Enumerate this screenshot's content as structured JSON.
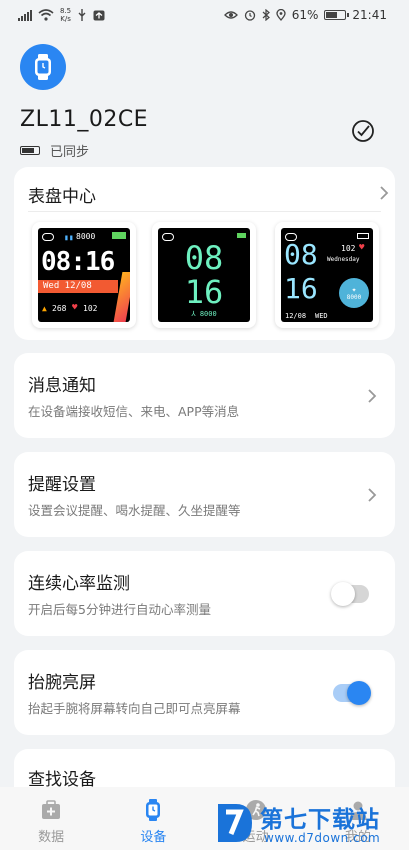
{
  "status_bar": {
    "net_speed_value": "8.5",
    "net_speed_unit": "K/s",
    "battery_percent": "61%",
    "battery_level": 0.61,
    "time": "21:41"
  },
  "device": {
    "name": "ZL11_02CE",
    "sync_status": "已同步",
    "battery_level": 0.8
  },
  "watchfaces": {
    "title": "表盘中心",
    "items": [
      {
        "steps": "8000",
        "time": "08:16",
        "date": "Wed  12/08",
        "calories": "268",
        "heart": "102"
      },
      {
        "hour": "08",
        "minute": "16",
        "steps": "8000"
      },
      {
        "heart": "102",
        "weekday": "Wednesday",
        "hour": "08",
        "minute": "16",
        "date": "12/08",
        "weekday_short": "WED",
        "steps": "8000"
      }
    ]
  },
  "settings": [
    {
      "title": "消息通知",
      "subtitle": "在设备端接收短信、来电、APP等消息",
      "control": "chevron"
    },
    {
      "title": "提醒设置",
      "subtitle": "设置会议提醒、喝水提醒、久坐提醒等",
      "control": "chevron"
    },
    {
      "title": "连续心率监测",
      "subtitle": "开启后每5分钟进行自动心率测量",
      "control": "toggle",
      "enabled": false
    },
    {
      "title": "抬腕亮屏",
      "subtitle": "抬起手腕将屏幕转向自己即可点亮屏幕",
      "control": "toggle",
      "enabled": true
    },
    {
      "title": "查找设备"
    }
  ],
  "bottom_nav": [
    {
      "label": "数据",
      "icon": "medkit-icon",
      "active": false
    },
    {
      "label": "设备",
      "icon": "watch-icon",
      "active": true
    },
    {
      "label": "运动",
      "icon": "run-icon",
      "active": false
    },
    {
      "label": "我的",
      "icon": "user-icon",
      "active": false
    }
  ],
  "watermark": {
    "title": "第七下载站",
    "url": "www.d7down.com"
  },
  "colors": {
    "accent": "#2a86f2",
    "background": "#f1f3f5",
    "card": "#ffffff",
    "toggle_off": "#d6d6d6",
    "heart": "#f0404a"
  }
}
